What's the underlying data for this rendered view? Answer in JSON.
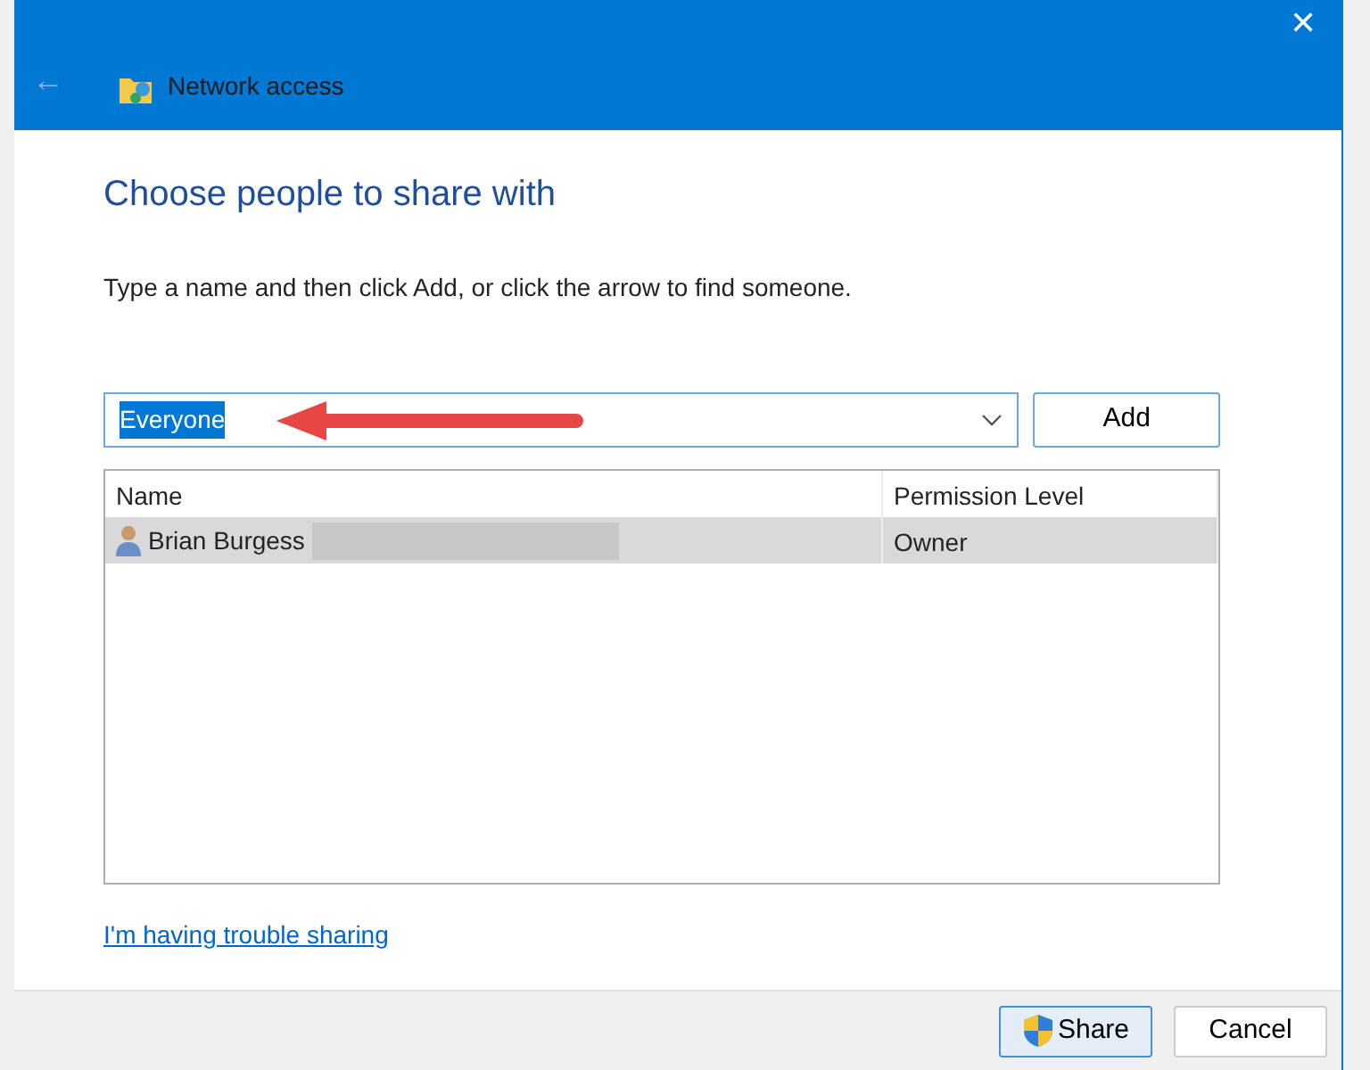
{
  "window": {
    "title": "Network access",
    "close": "✕",
    "back": "←"
  },
  "heading": "Choose people to share with",
  "instruction": "Type a name and then click Add, or click the arrow to find someone.",
  "name_field": {
    "value": "Everyone",
    "text_selected": true
  },
  "add_button": "Add",
  "table": {
    "columns": [
      "Name",
      "Permission Level"
    ],
    "rows": [
      {
        "name": "Brian Burgess",
        "permission": "Owner",
        "selected": true,
        "redacted": true
      }
    ]
  },
  "help_link": "I'm having trouble sharing",
  "buttons": [
    {
      "label": "Share",
      "kind": "shield",
      "focused": true
    },
    {
      "label": "Cancel",
      "kind": "plain",
      "focused": false
    }
  ]
}
